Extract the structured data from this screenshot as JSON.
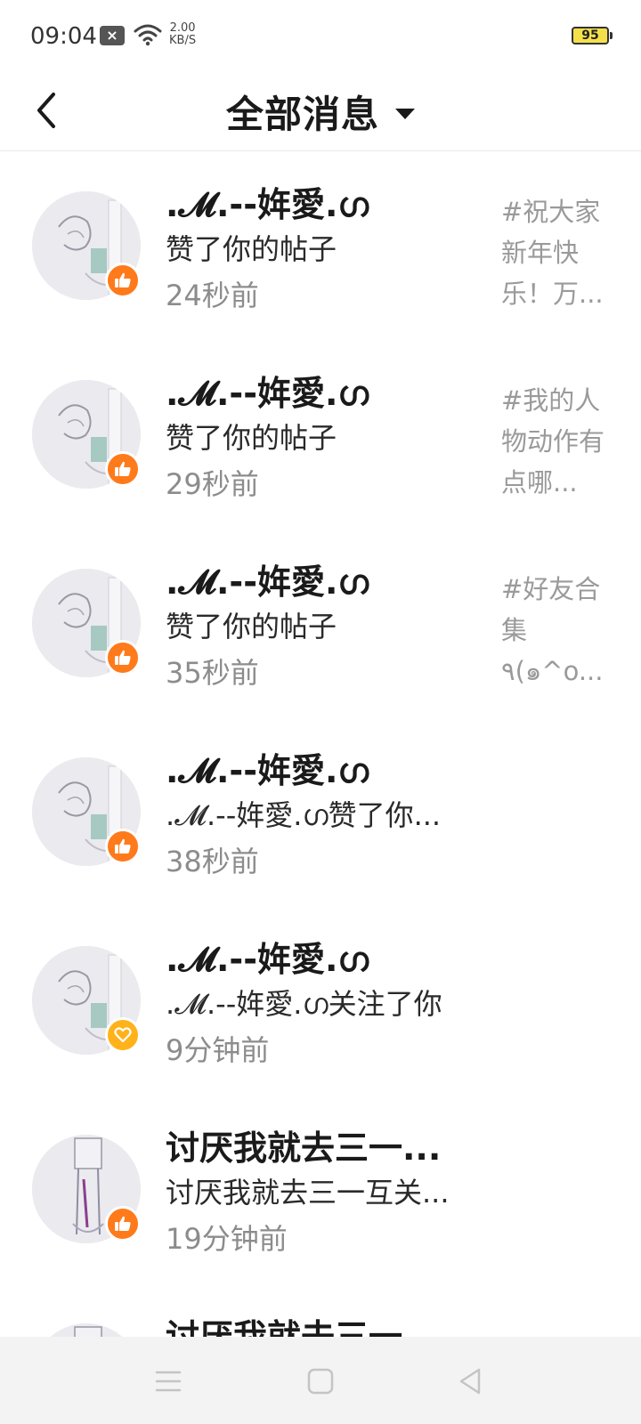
{
  "status": {
    "time": "09:04",
    "net_speed_value": "2.00",
    "net_speed_unit": "KB/S",
    "battery": "95"
  },
  "header": {
    "title": "全部消息"
  },
  "messages": [
    {
      "name": ".𝓜.--姩愛.ഗ",
      "action": "赞了你的帖子",
      "time": "24秒前",
      "preview": "#祝大家新年快乐！万...",
      "badge": "like"
    },
    {
      "name": ".𝓜.--姩愛.ഗ",
      "action": "赞了你的帖子",
      "time": "29秒前",
      "preview": "#我的人物动作有点哪...",
      "badge": "like"
    },
    {
      "name": ".𝓜.--姩愛.ഗ",
      "action": "赞了你的帖子",
      "time": "35秒前",
      "preview": "#好友合集٩(๑^o...",
      "badge": "like"
    },
    {
      "name": ".𝓜.--姩愛.ഗ",
      "action": ".𝓜.--姩愛.ഗ赞了你...",
      "time": "38秒前",
      "preview": "",
      "badge": "like"
    },
    {
      "name": ".𝓜.--姩愛.ഗ",
      "action": ".𝓜.--姩愛.ഗ关注了你",
      "time": "9分钟前",
      "preview": "",
      "badge": "heart"
    },
    {
      "name": "讨厌我就去三一...",
      "action": "讨厌我就去三一互关...",
      "time": "19分钟前",
      "preview": "",
      "badge": "like"
    },
    {
      "name": "讨厌我就去三一",
      "action": "",
      "time": "",
      "preview": "",
      "badge": "like"
    }
  ],
  "icons": {
    "back": "back-arrow-icon",
    "like_badge": "thumbs-up-icon",
    "follow_badge": "heart-icon",
    "nav_menu": "menu-icon",
    "nav_home": "home-square-icon",
    "nav_back": "back-triangle-icon"
  },
  "colors": {
    "like_badge": "#ff7a1a",
    "heart_badge": "#ffb21a",
    "battery": "#f5e04a",
    "muted_text": "#8c8c8c"
  }
}
